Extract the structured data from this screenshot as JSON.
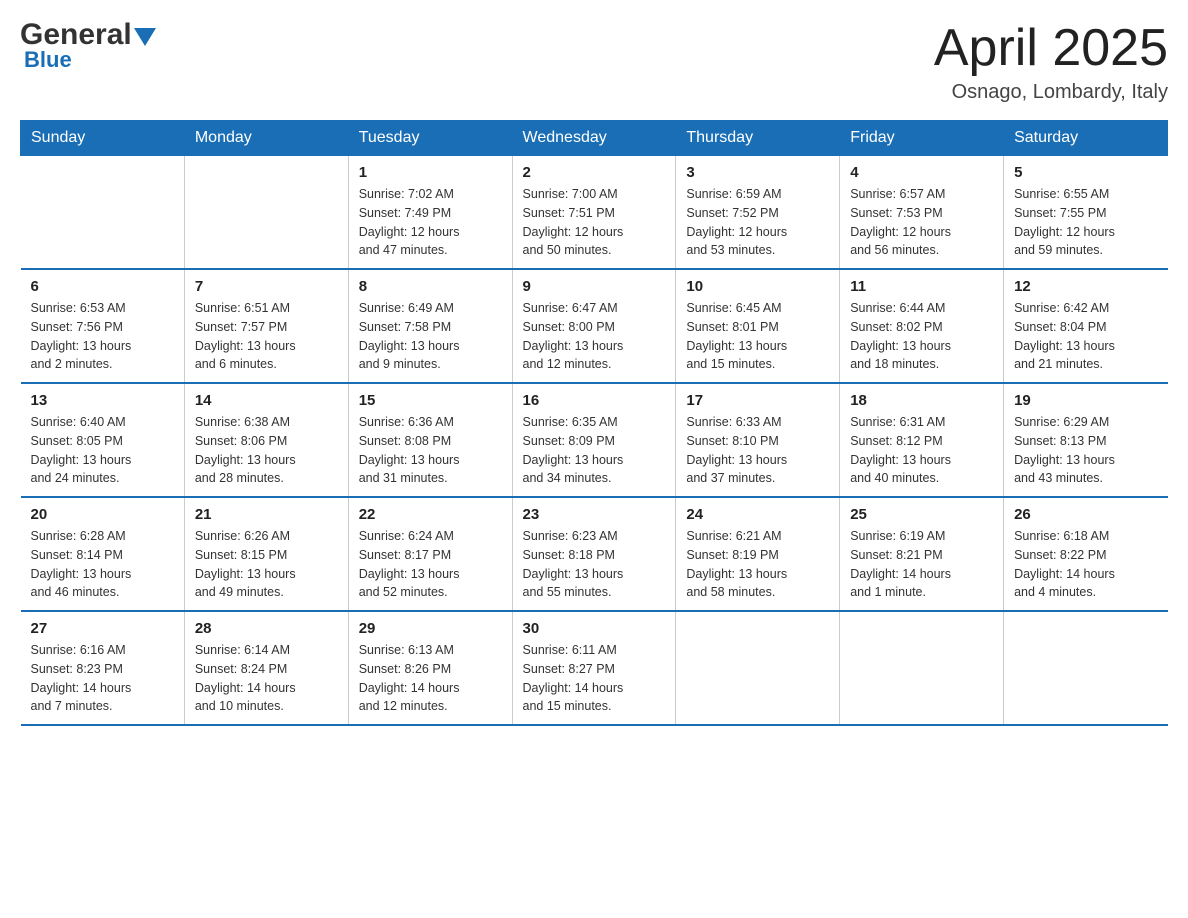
{
  "logo": {
    "general": "General",
    "arrow": "▼",
    "blue": "Blue"
  },
  "header": {
    "month": "April 2025",
    "location": "Osnago, Lombardy, Italy"
  },
  "weekdays": [
    "Sunday",
    "Monday",
    "Tuesday",
    "Wednesday",
    "Thursday",
    "Friday",
    "Saturday"
  ],
  "weeks": [
    [
      {
        "day": "",
        "info": ""
      },
      {
        "day": "",
        "info": ""
      },
      {
        "day": "1",
        "info": "Sunrise: 7:02 AM\nSunset: 7:49 PM\nDaylight: 12 hours\nand 47 minutes."
      },
      {
        "day": "2",
        "info": "Sunrise: 7:00 AM\nSunset: 7:51 PM\nDaylight: 12 hours\nand 50 minutes."
      },
      {
        "day": "3",
        "info": "Sunrise: 6:59 AM\nSunset: 7:52 PM\nDaylight: 12 hours\nand 53 minutes."
      },
      {
        "day": "4",
        "info": "Sunrise: 6:57 AM\nSunset: 7:53 PM\nDaylight: 12 hours\nand 56 minutes."
      },
      {
        "day": "5",
        "info": "Sunrise: 6:55 AM\nSunset: 7:55 PM\nDaylight: 12 hours\nand 59 minutes."
      }
    ],
    [
      {
        "day": "6",
        "info": "Sunrise: 6:53 AM\nSunset: 7:56 PM\nDaylight: 13 hours\nand 2 minutes."
      },
      {
        "day": "7",
        "info": "Sunrise: 6:51 AM\nSunset: 7:57 PM\nDaylight: 13 hours\nand 6 minutes."
      },
      {
        "day": "8",
        "info": "Sunrise: 6:49 AM\nSunset: 7:58 PM\nDaylight: 13 hours\nand 9 minutes."
      },
      {
        "day": "9",
        "info": "Sunrise: 6:47 AM\nSunset: 8:00 PM\nDaylight: 13 hours\nand 12 minutes."
      },
      {
        "day": "10",
        "info": "Sunrise: 6:45 AM\nSunset: 8:01 PM\nDaylight: 13 hours\nand 15 minutes."
      },
      {
        "day": "11",
        "info": "Sunrise: 6:44 AM\nSunset: 8:02 PM\nDaylight: 13 hours\nand 18 minutes."
      },
      {
        "day": "12",
        "info": "Sunrise: 6:42 AM\nSunset: 8:04 PM\nDaylight: 13 hours\nand 21 minutes."
      }
    ],
    [
      {
        "day": "13",
        "info": "Sunrise: 6:40 AM\nSunset: 8:05 PM\nDaylight: 13 hours\nand 24 minutes."
      },
      {
        "day": "14",
        "info": "Sunrise: 6:38 AM\nSunset: 8:06 PM\nDaylight: 13 hours\nand 28 minutes."
      },
      {
        "day": "15",
        "info": "Sunrise: 6:36 AM\nSunset: 8:08 PM\nDaylight: 13 hours\nand 31 minutes."
      },
      {
        "day": "16",
        "info": "Sunrise: 6:35 AM\nSunset: 8:09 PM\nDaylight: 13 hours\nand 34 minutes."
      },
      {
        "day": "17",
        "info": "Sunrise: 6:33 AM\nSunset: 8:10 PM\nDaylight: 13 hours\nand 37 minutes."
      },
      {
        "day": "18",
        "info": "Sunrise: 6:31 AM\nSunset: 8:12 PM\nDaylight: 13 hours\nand 40 minutes."
      },
      {
        "day": "19",
        "info": "Sunrise: 6:29 AM\nSunset: 8:13 PM\nDaylight: 13 hours\nand 43 minutes."
      }
    ],
    [
      {
        "day": "20",
        "info": "Sunrise: 6:28 AM\nSunset: 8:14 PM\nDaylight: 13 hours\nand 46 minutes."
      },
      {
        "day": "21",
        "info": "Sunrise: 6:26 AM\nSunset: 8:15 PM\nDaylight: 13 hours\nand 49 minutes."
      },
      {
        "day": "22",
        "info": "Sunrise: 6:24 AM\nSunset: 8:17 PM\nDaylight: 13 hours\nand 52 minutes."
      },
      {
        "day": "23",
        "info": "Sunrise: 6:23 AM\nSunset: 8:18 PM\nDaylight: 13 hours\nand 55 minutes."
      },
      {
        "day": "24",
        "info": "Sunrise: 6:21 AM\nSunset: 8:19 PM\nDaylight: 13 hours\nand 58 minutes."
      },
      {
        "day": "25",
        "info": "Sunrise: 6:19 AM\nSunset: 8:21 PM\nDaylight: 14 hours\nand 1 minute."
      },
      {
        "day": "26",
        "info": "Sunrise: 6:18 AM\nSunset: 8:22 PM\nDaylight: 14 hours\nand 4 minutes."
      }
    ],
    [
      {
        "day": "27",
        "info": "Sunrise: 6:16 AM\nSunset: 8:23 PM\nDaylight: 14 hours\nand 7 minutes."
      },
      {
        "day": "28",
        "info": "Sunrise: 6:14 AM\nSunset: 8:24 PM\nDaylight: 14 hours\nand 10 minutes."
      },
      {
        "day": "29",
        "info": "Sunrise: 6:13 AM\nSunset: 8:26 PM\nDaylight: 14 hours\nand 12 minutes."
      },
      {
        "day": "30",
        "info": "Sunrise: 6:11 AM\nSunset: 8:27 PM\nDaylight: 14 hours\nand 15 minutes."
      },
      {
        "day": "",
        "info": ""
      },
      {
        "day": "",
        "info": ""
      },
      {
        "day": "",
        "info": ""
      }
    ]
  ]
}
